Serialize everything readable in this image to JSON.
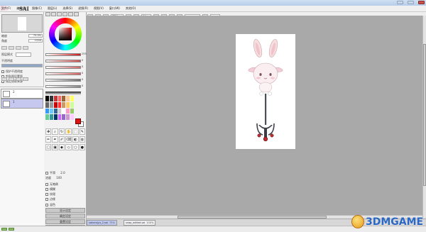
{
  "window": {
    "title": ""
  },
  "menu": {
    "items": [
      "文件(F)",
      "编辑(E)",
      "图像(C)",
      "图层(L)",
      "选择(S)",
      "滤镜(R)",
      "视图(V)",
      "窗口(W)",
      "其他(O)"
    ]
  },
  "toolbar": {
    "zoom_value": "75%",
    "rotate_value": "0°",
    "zoom_label": "",
    "right_label": ""
  },
  "navigator": {
    "zoom_label": "缩放",
    "zoom_value": "75.0%",
    "angle_label": "角度",
    "angle_value": "+000"
  },
  "layer_props": {
    "blend_label": "图层模式",
    "opacity_label": "不透明度",
    "opacity_value": "100%",
    "protect_label": "保护不透明度",
    "clip_label": "剪贴图层蒙版",
    "ref_label": "指定选取来源"
  },
  "layers": [
    {
      "number": "2",
      "selected": false
    },
    {
      "number": "1",
      "selected": true
    }
  ],
  "color_sliders": [
    {
      "value": "255",
      "color": "#d01818"
    },
    {
      "value": "0",
      "color": "#d45050"
    },
    {
      "value": "0",
      "color": "#d46a6a"
    },
    {
      "value": "0",
      "color": "#e06060"
    },
    {
      "value": "0",
      "color": "#6f6f6f"
    },
    {
      "value": "0",
      "color": "#888888"
    }
  ],
  "gray_sliders": [
    "#3a3a3a",
    "#5f5f5f",
    "#8a8a8a",
    "#b7b7b7",
    "#e2e2e2"
  ],
  "swatches": [
    "#000",
    "#333",
    "#c33",
    "#f66",
    "#963",
    "#fc9",
    "#ff6",
    "#666",
    "#999",
    "#c00",
    "#f33",
    "#c96",
    "#fc6",
    "#cf9",
    "#39f",
    "#6cf",
    "#369",
    "#ccc",
    "#fff",
    "#f9c",
    "#9c6",
    "#6c9",
    "#399",
    "#036",
    "#c6f",
    "#96c",
    "#c9c",
    "#fcf"
  ],
  "fg_color": "#e11111",
  "tools": [
    "✥",
    "⌕",
    "↻",
    "✋",
    "⬚",
    "✎",
    "✏",
    "✒",
    "✐",
    "⌫",
    "◐",
    "◍",
    "▢",
    "▣",
    "◆",
    "◇",
    "○",
    "●"
  ],
  "brush_options": {
    "pressure_label": "平滑",
    "size_value": "2.0",
    "density_label": "浓度",
    "density_value": "100",
    "options": [
      "无笔刷",
      "模糊",
      "纹理",
      "边缘"
    ],
    "blending_label": "混色"
  },
  "buttons": [
    "显示设定",
    "确定设定",
    "重置设定",
    "删除设定"
  ],
  "file_tabs": [
    {
      "name": "\u0000sakurajyu_2.sai",
      "zoom": "75%",
      "active": true
    },
    {
      "name": "snap_edited.sai",
      "zoom": "100%",
      "active": false
    }
  ],
  "watermark": {
    "text": "3DMGAME"
  }
}
